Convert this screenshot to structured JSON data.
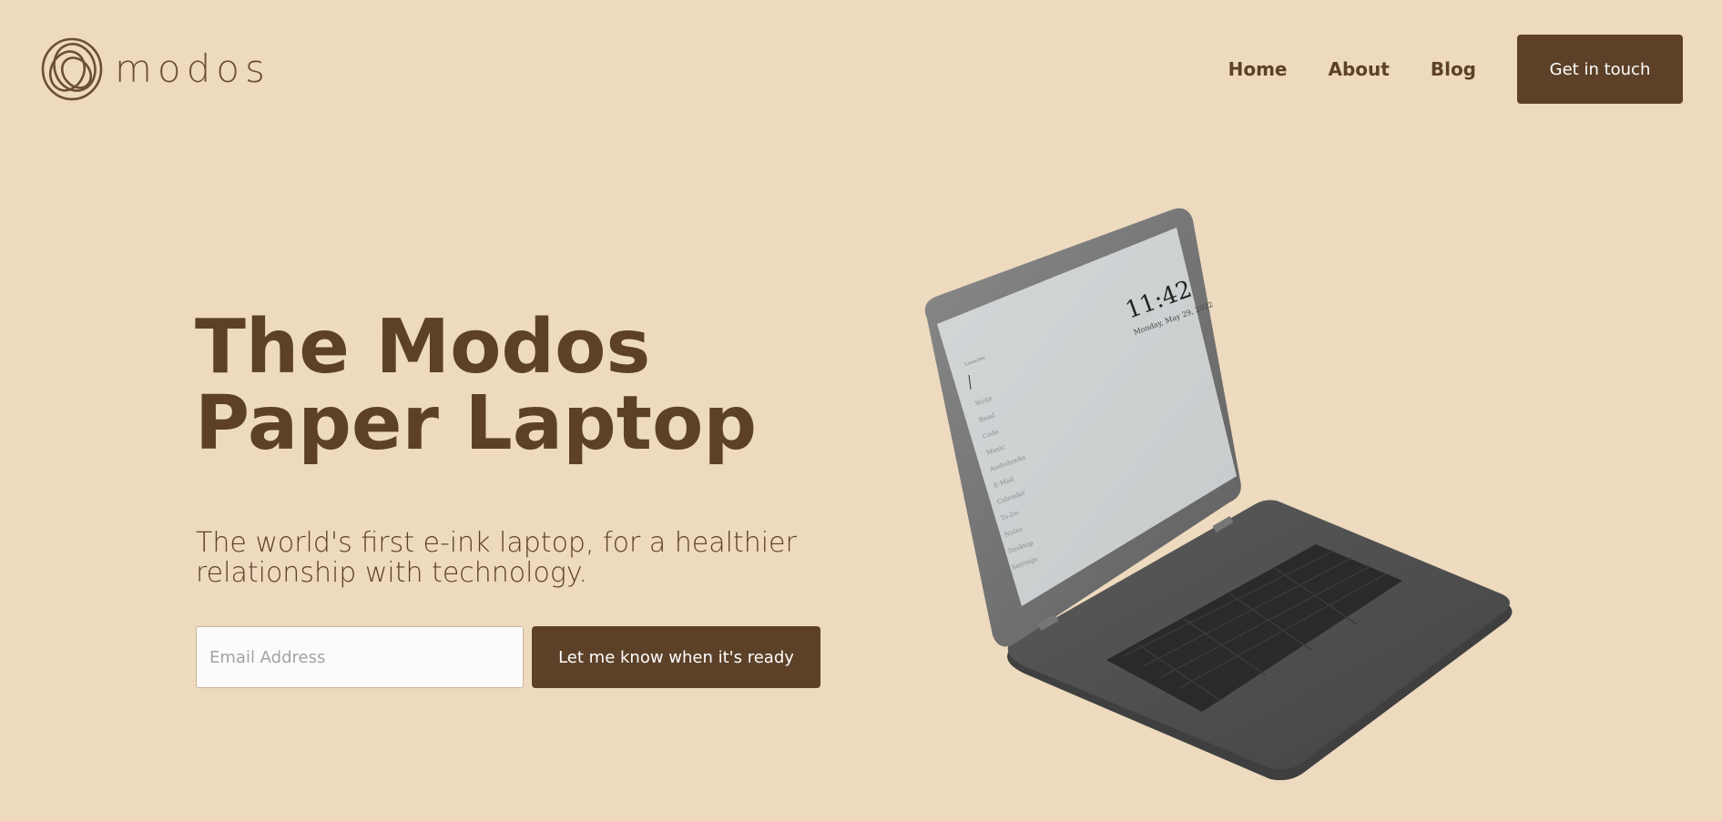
{
  "brand": {
    "name": "modos",
    "logo_icon": "modos-swirl-icon",
    "color": "#5c4128"
  },
  "nav": {
    "links": [
      {
        "label": "Home"
      },
      {
        "label": "About"
      },
      {
        "label": "Blog"
      }
    ],
    "cta_label": "Get in touch"
  },
  "hero": {
    "title": "The Modos Paper Laptop",
    "subtitle": "The world's first e-ink laptop, for a healthier relationship with technology.",
    "email_placeholder": "Email Address",
    "email_value": "",
    "submit_label": "Let me know when it's ready"
  },
  "device": {
    "clock": "11:42",
    "date": "Monday, May 29, 2022",
    "menu_title": "Launcher",
    "menu_items": [
      "Write",
      "Read",
      "Code",
      "Music",
      "Audiobooks",
      "E-Mail",
      "Calendar",
      "To-Do",
      "Notes",
      "Desktop",
      "Settings"
    ]
  },
  "colors": {
    "background": "#eddabf",
    "accent": "#5c4128",
    "device_body": "#4a4a4a",
    "screen": "#cfd3d4"
  }
}
